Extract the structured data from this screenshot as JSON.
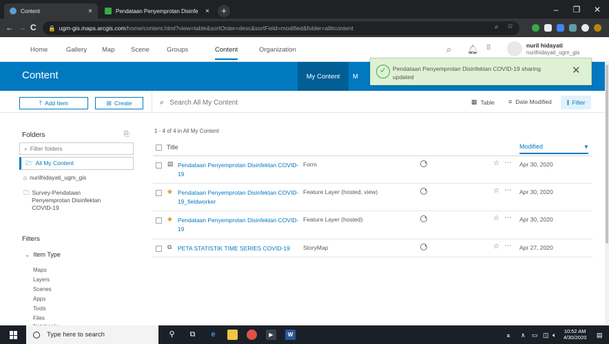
{
  "browser": {
    "tabs": [
      {
        "title": "Content",
        "close": "×"
      },
      {
        "title": "Pendataan Penyemprotan Disinfe",
        "close": "×"
      }
    ],
    "new_tab": "+",
    "address": {
      "lock": "🔒",
      "host": "ugm-gis.maps.arcgis.com",
      "path": "/home/content.html?view=table&sortOrder=desc&sortField=modified&folder=all#content"
    },
    "nav": {
      "back": "←",
      "forward": "→",
      "reload": "C"
    },
    "window": {
      "minimize": "–",
      "maximize": "❐",
      "close": "✕"
    }
  },
  "topnav": {
    "items": [
      "Home",
      "Gallery",
      "Map",
      "Scene",
      "Groups",
      "Content",
      "Organization"
    ],
    "active": "Content",
    "user_name": "nuril hidayati",
    "user_id": "nurilhidayati_ugm_gis"
  },
  "banner": {
    "title": "Content",
    "tab_my_content": "My Content",
    "tab_partial": "M"
  },
  "toast": {
    "message": "Pendataan Penyemprotan Disinfektan COVID-19 sharing updated",
    "close": "✕",
    "check": "✓"
  },
  "actions": {
    "add_item": "Add Item",
    "create": "Create",
    "search_placeholder": "Search All My Content",
    "view_table": "Table",
    "sort": "Date Modified",
    "filter": "Filter"
  },
  "sidebar": {
    "folders_heading": "Folders",
    "filter_placeholder": "Filter folders",
    "folders": [
      "All My Content",
      "nurilhidayati_ugm_gis",
      "Survey-Pendataan Penyemprotan Disinfektan COVID-19"
    ],
    "filters_heading": "Filters",
    "item_type_heading": "Item Type",
    "item_types": [
      "Maps",
      "Layers",
      "Scenes",
      "Apps",
      "Tools",
      "Files",
      "Notebooks"
    ]
  },
  "list": {
    "count": "1 - 4 of 4 in All My Content",
    "col_title": "Title",
    "col_modified": "Modified",
    "rows": [
      {
        "title": "Pendataan Penyemprotan Disinfektan COVID-19",
        "type": "Form",
        "date": "Apr 30, 2020",
        "icon": "form-icon"
      },
      {
        "title": "Pendataan Penyemprotan Disinfektan COVID-19_fieldworker",
        "type": "Feature Layer (hosted, view)",
        "date": "Apr 30, 2020",
        "icon": "feature-layer-icon"
      },
      {
        "title": "Pendataan Penyemprotan Disinfektan COVID-19",
        "type": "Feature Layer (hosted)",
        "date": "Apr 30, 2020",
        "icon": "feature-layer-icon"
      },
      {
        "title": "PETA STATISTIK TIME SERIES COVID-19",
        "type": "StoryMap",
        "date": "Apr 27, 2020",
        "icon": "storymap-icon"
      }
    ]
  },
  "taskbar": {
    "search_placeholder": "Type here to search",
    "time": "10:52 AM",
    "date": "4/30/2020"
  },
  "colors": {
    "accent": "#0079c1",
    "banner": "#0079c1",
    "toast": "#dff1d5"
  }
}
